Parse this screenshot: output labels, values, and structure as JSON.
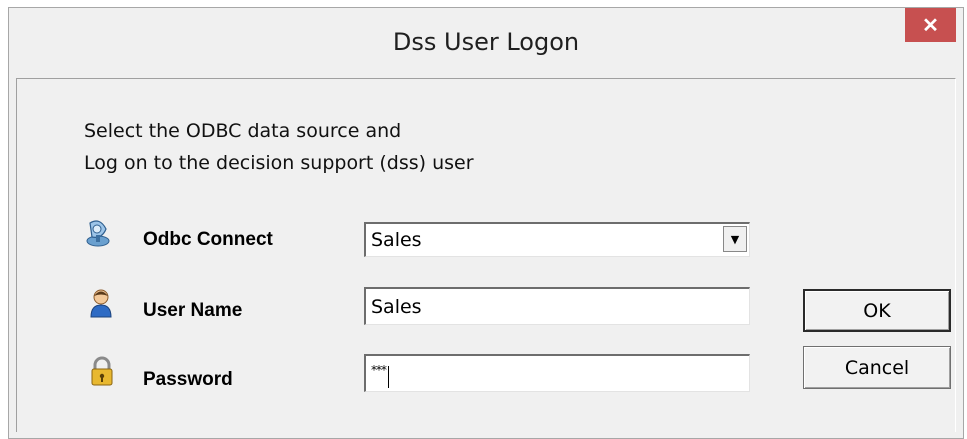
{
  "window": {
    "title": "Dss User Logon",
    "close_glyph": "✕"
  },
  "instructions": {
    "line1": "Select the ODBC data source and",
    "line2": "Log on to the decision support (dss) user"
  },
  "form": {
    "odbc": {
      "label": "Odbc Connect",
      "value": "Sales",
      "icon": "odbc-connect-icon",
      "dropdown_glyph": "▼"
    },
    "user": {
      "label": "User Name",
      "value": "Sales",
      "icon": "user-icon"
    },
    "password": {
      "label": "Password",
      "value": "***",
      "icon": "padlock-icon"
    }
  },
  "buttons": {
    "ok": "OK",
    "cancel": "Cancel"
  },
  "colors": {
    "close_bg": "#c75050",
    "dialog_bg": "#f0f0f0"
  }
}
